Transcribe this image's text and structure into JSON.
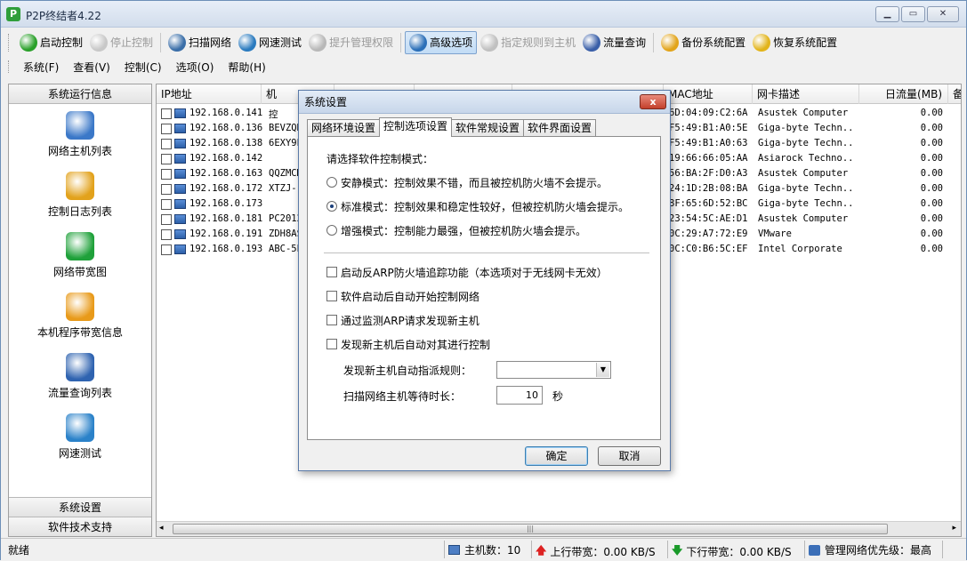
{
  "window": {
    "title": "P2P终结者4.22",
    "app_icon": "P"
  },
  "toolbar": {
    "buttons": [
      {
        "label": "启动控制",
        "icon": "check-icon",
        "color": "#2aa02a",
        "disabled": false,
        "active": false
      },
      {
        "label": "停止控制",
        "icon": "stop-icon",
        "color": "#c8c8c8",
        "disabled": true,
        "active": false
      },
      {
        "label": "扫描网络",
        "icon": "magnifier-icon",
        "color": "#3a6ea8",
        "disabled": false,
        "active": false
      },
      {
        "label": "网速测试",
        "icon": "globe-icon",
        "color": "#2b7bbf",
        "disabled": false,
        "active": false
      },
      {
        "label": "提升管理权限",
        "icon": "shield-icon",
        "color": "#b8b8b8",
        "disabled": true,
        "active": false
      },
      {
        "label": "高级选项",
        "icon": "globe-gear-icon",
        "color": "#2b6fb8",
        "disabled": false,
        "active": true
      },
      {
        "label": "指定规则到主机",
        "icon": "rules-icon",
        "color": "#c0c0c0",
        "disabled": true,
        "active": false
      },
      {
        "label": "流量查询",
        "icon": "query-icon",
        "color": "#3a5fa8",
        "disabled": false,
        "active": false
      },
      {
        "label": "备份系统配置",
        "icon": "backup-icon",
        "color": "#e2a41a",
        "disabled": false,
        "active": false
      },
      {
        "label": "恢复系统配置",
        "icon": "restore-icon",
        "color": "#e2b41a",
        "disabled": false,
        "active": false
      }
    ]
  },
  "menubar": {
    "items": [
      "系统(F)",
      "查看(V)",
      "控制(C)",
      "选项(O)",
      "帮助(H)"
    ]
  },
  "sidebar": {
    "header": "系统运行信息",
    "items": [
      {
        "label": "网络主机列表",
        "icon": "network-hosts-icon",
        "color": "#3b78c8"
      },
      {
        "label": "控制日志列表",
        "icon": "pencil-log-icon",
        "color": "#e2a21c"
      },
      {
        "label": "网络带宽图",
        "icon": "bandwidth-chart-icon",
        "color": "#1fa13a"
      },
      {
        "label": "本机程序带宽信息",
        "icon": "gear-window-icon",
        "color": "#e89a1a"
      },
      {
        "label": "流量查询列表",
        "icon": "magnifier-window-icon",
        "color": "#2f63b0"
      },
      {
        "label": "网速测试",
        "icon": "globe-icon",
        "color": "#2b82c9"
      }
    ],
    "footer_items": [
      "系统设置",
      "软件技术支持"
    ]
  },
  "table": {
    "columns": [
      "IP地址",
      "机",
      "",
      "",
      "",
      "MAC地址",
      "网卡描述",
      "日流量(MB)",
      "备"
    ],
    "rows": [
      {
        "ip": "192.168.0.141",
        "name": "控",
        "mac": "6D:04:09:C2:6A",
        "nic": "Asustek Computer",
        "flow": "0.00"
      },
      {
        "ip": "192.168.0.136",
        "name": "BEVZQH",
        "mac": "F5:49:B1:A0:5E",
        "nic": "Giga-byte Techn...",
        "flow": "0.00"
      },
      {
        "ip": "192.168.0.138",
        "name": "6EXY9E",
        "mac": "F5:49:B1:A0:63",
        "nic": "Giga-byte Techn...",
        "flow": "0.00"
      },
      {
        "ip": "192.168.0.142",
        "name": "",
        "mac": "19:66:66:05:AA",
        "nic": "Asiarock Techno...",
        "flow": "0.00"
      },
      {
        "ip": "192.168.0.163",
        "name": "QQZMCM",
        "mac": "56:BA:2F:D0:A3",
        "nic": "Asustek Computer",
        "flow": "0.00"
      },
      {
        "ip": "192.168.0.172",
        "name": "XTZJ-",
        "mac": "24:1D:2B:08:BA",
        "nic": "Giga-byte Techn...",
        "flow": "0.00"
      },
      {
        "ip": "192.168.0.173",
        "name": "",
        "mac": "8F:65:6D:52:BC",
        "nic": "Giga-byte Techn...",
        "flow": "0.00"
      },
      {
        "ip": "192.168.0.181",
        "name": "PC2012",
        "mac": "23:54:5C:AE:D1",
        "nic": "Asustek Computer",
        "flow": "0.00"
      },
      {
        "ip": "192.168.0.191",
        "name": "ZDH8AS",
        "mac": "0C:29:A7:72:E9",
        "nic": "VMware",
        "flow": "0.00"
      },
      {
        "ip": "192.168.0.193",
        "name": "ABC-5E",
        "mac": "0C:C0:B6:5C:EF",
        "nic": "Intel Corporate",
        "flow": "0.00"
      }
    ]
  },
  "statusbar": {
    "ready": "就绪",
    "host_count": "主机数：10",
    "upload": "上行带宽：0.00 KB/S",
    "download": "下行带宽：0.00 KB/S",
    "priority": "管理网络优先级：最高"
  },
  "dialog": {
    "title": "系统设置",
    "close_label": "x",
    "tabs": [
      "网络环境设置",
      "控制选项设置",
      "软件常规设置",
      "软件界面设置"
    ],
    "active_tab": 1,
    "mode_prompt": "请选择软件控制模式：",
    "modes": [
      {
        "label": "安静模式：控制效果不错，而且被控机防火墙不会提示。",
        "selected": false
      },
      {
        "label": "标准模式：控制效果和稳定性较好，但被控机防火墙会提示。",
        "selected": true
      },
      {
        "label": "增强模式：控制能力最强，但被控机防火墙会提示。",
        "selected": false
      }
    ],
    "options": [
      {
        "label": "启动反ARP防火墙追踪功能（本选项对于无线网卡无效）",
        "checked": false
      },
      {
        "label": "软件启动后自动开始控制网络",
        "checked": false
      },
      {
        "label": "通过监测ARP请求发现新主机",
        "checked": false
      },
      {
        "label": "发现新主机后自动对其进行控制",
        "checked": false
      }
    ],
    "rule_label": "发现新主机自动指派规则：",
    "rule_value": "",
    "wait_label": "扫描网络主机等待时长：",
    "wait_value": "10",
    "wait_unit": "秒",
    "ok_label": "确定",
    "cancel_label": "取消"
  }
}
